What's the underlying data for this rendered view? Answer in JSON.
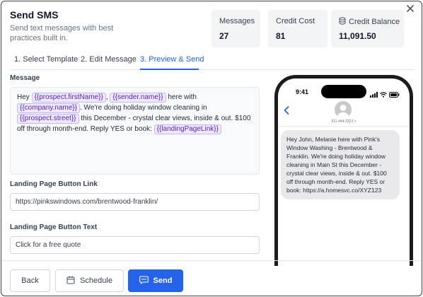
{
  "header": {
    "title": "Send SMS",
    "subtitle": "Send text messages with best practices built in.",
    "close_icon": "close-icon"
  },
  "stats": [
    {
      "label": "Messages",
      "value": "27"
    },
    {
      "label": "Credit Cost",
      "value": "81"
    },
    {
      "label": "Credit Balance",
      "value": "11,091.50",
      "icon": "database-icon"
    }
  ],
  "tabs": [
    {
      "label": "1. Select Template",
      "active": false
    },
    {
      "label": "2. Edit Message",
      "active": false
    },
    {
      "label": "3. Preview & Send",
      "active": true
    }
  ],
  "message": {
    "label": "Message",
    "parts": [
      {
        "t": "Hey "
      },
      {
        "var": "{{prospect.firstName}}"
      },
      {
        "t": ", "
      },
      {
        "var": "{{sender.name}}"
      },
      {
        "t": " here with "
      },
      {
        "var": "{{company.name}}"
      },
      {
        "t": ". We're doing holiday window cleaning in "
      },
      {
        "var": "{{prospect.street}}"
      },
      {
        "t": " this December - crystal clear views, inside & out. $100 off through month-end. Reply YES or book: "
      },
      {
        "var": "{{landingPageLink}}"
      }
    ]
  },
  "landing_link": {
    "label": "Landing Page Button Link",
    "value": "https://pinkswindows.com/brentwood-franklin/"
  },
  "landing_text": {
    "label": "Landing Page Button Text",
    "value": "Click for a free quote"
  },
  "phone": {
    "time": "9:41",
    "contact_number": "311-444-2323 >",
    "preview_text": "Hey John, Melanie here with Pink's Window Washing - Brentwood & Franklin. We're doing holiday window cleaning in Main St this December - crystal clear views, inside & out. $100 off through month-end. Reply YES or book: https://a.homesvc.co/XYZ123"
  },
  "footer": {
    "back_label": "Back",
    "schedule_label": "Schedule",
    "send_label": "Send"
  },
  "colors": {
    "accent": "#2563eb",
    "chip_bg": "#ede9fe",
    "chip_text": "#5b21b6",
    "stat_bg": "#f3f4f6"
  }
}
